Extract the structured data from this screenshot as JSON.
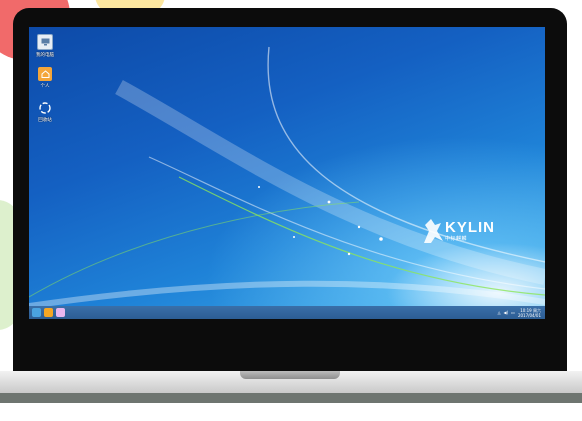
{
  "desktop": {
    "icons": [
      {
        "label": "我的电脑",
        "icon": "computer-icon"
      },
      {
        "label": "个人",
        "icon": "home-folder-icon"
      },
      {
        "label": "回收站",
        "icon": "trash-icon"
      }
    ]
  },
  "branding": {
    "logo_word": "KYLIN",
    "logo_sub": "中标麒麟"
  },
  "taskbar": {
    "buttons": [
      "start-menu-icon",
      "file-manager-icon",
      "folder-icon"
    ],
    "time": "10:19 周六",
    "date": "2017/04/01"
  },
  "colors": {
    "accent": "#1f83d8",
    "taskbar": "#2c5d94"
  }
}
